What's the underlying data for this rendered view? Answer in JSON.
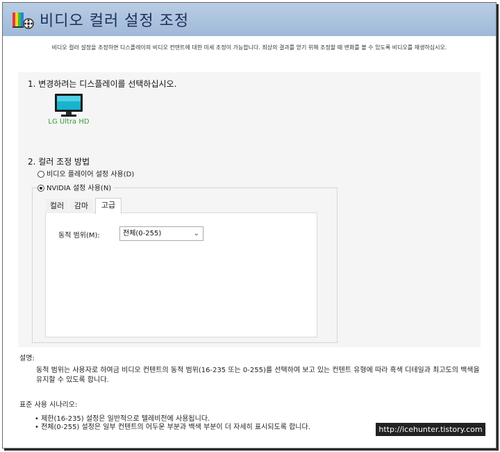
{
  "header": {
    "title": "비디오 컬러 설정 조정"
  },
  "intro": "비디오 컬러 설정을 조정하면 디스플레이의 비디오 컨텐트에 대한 미세 조정이 가능합니다. 최상의 결과를 얻기 위해 조정할 때 변화를 볼 수 있도록 비디오를 재생하십시오.",
  "step1": {
    "label": "1. 변경하려는 디스플레이를 선택하십시오.",
    "display": "LG Ultra HD"
  },
  "step2": {
    "label": "2. 컬러 조정 방법",
    "options": [
      {
        "label": "비디오 플레이어 설정 사용(D)",
        "selected": false
      },
      {
        "label": "NVIDIA 설정 사용(N)",
        "selected": true
      }
    ]
  },
  "tabs": [
    {
      "label": "컬러",
      "active": false
    },
    {
      "label": "감마",
      "active": false
    },
    {
      "label": "고급",
      "active": true
    }
  ],
  "advanced": {
    "dynamic_range_label": "동적 범위(M):",
    "dynamic_range_value": "전체(0-255)"
  },
  "description": {
    "label": "설명:",
    "text": "동적 범위는 사용자로 하여금 비디오 컨텐트의 동적 범위(16-235 또는 0-255)를 선택하여 보고 있는 컨텐트 유형에 따라 흑색 디테일과 최고도의 백색을 유지할 수 있도록 합니다."
  },
  "scenarios": {
    "label": "표준 사용 시나리오:",
    "items": [
      "제한(16-235) 설정은 일반적으로 텔레비전에 사용됩니다.",
      "전체(0-255) 설정은 일부 컨텐트의 어두운 부분과 백색 부분이 더 자세히 표시되도록 합니다."
    ]
  },
  "watermark": "http://icehunter.tistory.com",
  "colors": {
    "header_start": "#b9cde4",
    "header_end": "#9fb9d8",
    "title": "#1c2e5a",
    "display_label": "#3a9a3a"
  }
}
